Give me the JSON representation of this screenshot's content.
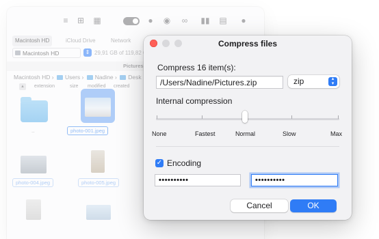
{
  "background_window": {
    "toolbar_icons": [
      "list-icon",
      "columns-icon",
      "grid-icon",
      "toggle-icon",
      "info-icon",
      "eye-icon",
      "binoculars-icon",
      "panes-icon",
      "archive-icon",
      "info-circle-icon"
    ],
    "location_tabs": [
      "Macintosh HD",
      "iCloud Drive",
      "Network"
    ],
    "drive": {
      "name": "Macintosh HD",
      "capacity": "29,91 GB of 119,82 GB fr"
    },
    "folder_header": "Pictures",
    "breadcrumb": [
      "Macintosh HD",
      "Users",
      "Nadine",
      "Desk"
    ],
    "columns": [
      "extension",
      "size",
      "modified",
      "created"
    ],
    "items": [
      {
        "name": "..",
        "kind": "folder"
      },
      {
        "name": "photo-001.jpeg",
        "kind": "image",
        "selected": true
      },
      {
        "name": "photo-004.jpeg",
        "kind": "image"
      },
      {
        "name": "photo-005.jpeg",
        "kind": "image"
      }
    ]
  },
  "dialog": {
    "title": "Compress files",
    "compress_label": "Compress 16 item(s):",
    "path_value": "/Users/Nadine/Pictures.zip",
    "format": {
      "selected": "zip"
    },
    "compression_label": "Internal compression",
    "compression_levels": [
      "None",
      "Fastest",
      "Normal",
      "Slow",
      "Max"
    ],
    "compression_selected": "Normal",
    "encoding_label": "Encoding",
    "encoding_checked": true,
    "password": "••••••••••",
    "password_confirm": "••••••••••",
    "cancel_label": "Cancel",
    "ok_label": "OK"
  },
  "colors": {
    "accent": "#2f7cf6",
    "close": "#fe5f57",
    "dialog_bg": "#f2f2f4"
  }
}
